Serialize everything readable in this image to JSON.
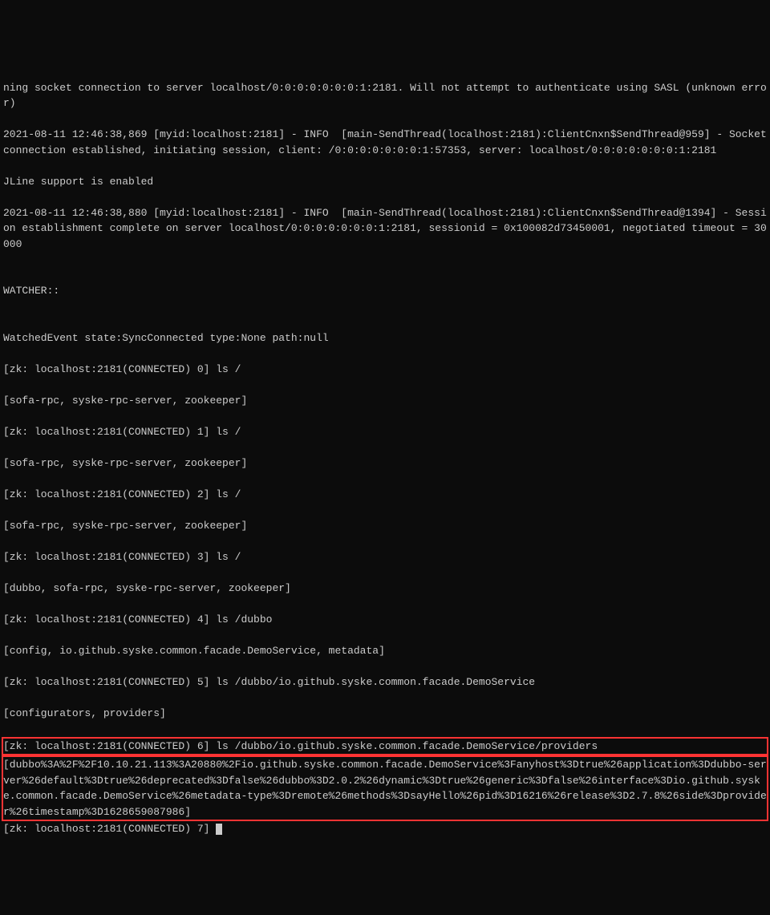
{
  "terminal": {
    "lines": [
      "ning socket connection to server localhost/0:0:0:0:0:0:0:1:2181. Will not attempt to authenticate using SASL (unknown error)",
      "2021-08-11 12:46:38,869 [myid:localhost:2181] - INFO  [main-SendThread(localhost:2181):ClientCnxn$SendThread@959] - Socket connection established, initiating session, client: /0:0:0:0:0:0:0:1:57353, server: localhost/0:0:0:0:0:0:0:1:2181",
      "JLine support is enabled",
      "2021-08-11 12:46:38,880 [myid:localhost:2181] - INFO  [main-SendThread(localhost:2181):ClientCnxn$SendThread@1394] - Session establishment complete on server localhost/0:0:0:0:0:0:0:1:2181, sessionid = 0x100082d73450001, negotiated timeout = 30000",
      "",
      "WATCHER::",
      "",
      "WatchedEvent state:SyncConnected type:None path:null",
      "[zk: localhost:2181(CONNECTED) 0] ls /",
      "[sofa-rpc, syske-rpc-server, zookeeper]",
      "[zk: localhost:2181(CONNECTED) 1] ls /",
      "[sofa-rpc, syske-rpc-server, zookeeper]",
      "[zk: localhost:2181(CONNECTED) 2] ls /",
      "[sofa-rpc, syske-rpc-server, zookeeper]",
      "[zk: localhost:2181(CONNECTED) 3] ls /",
      "[dubbo, sofa-rpc, syske-rpc-server, zookeeper]",
      "[zk: localhost:2181(CONNECTED) 4] ls /dubbo",
      "[config, io.github.syske.common.facade.DemoService, metadata]",
      "[zk: localhost:2181(CONNECTED) 5] ls /dubbo/io.github.syske.common.facade.DemoService",
      "[configurators, providers]"
    ],
    "highlight1": "[zk: localhost:2181(CONNECTED) 6] ls /dubbo/io.github.syske.common.facade.DemoService/providers",
    "highlight2": "[dubbo%3A%2F%2F10.10.21.113%3A20880%2Fio.github.syske.common.facade.DemoService%3Fanyhost%3Dtrue%26application%3Ddubbo-server%26default%3Dtrue%26deprecated%3Dfalse%26dubbo%3D2.0.2%26dynamic%3Dtrue%26generic%3Dfalse%26interface%3Dio.github.syske.common.facade.DemoService%26metadata-type%3Dremote%26methods%3DsayHello%26pid%3D16216%26release%3D2.7.8%26side%3Dprovider%26timestamp%3D1628659087986]",
    "prompt_final": "[zk: localhost:2181(CONNECTED) 7] "
  }
}
